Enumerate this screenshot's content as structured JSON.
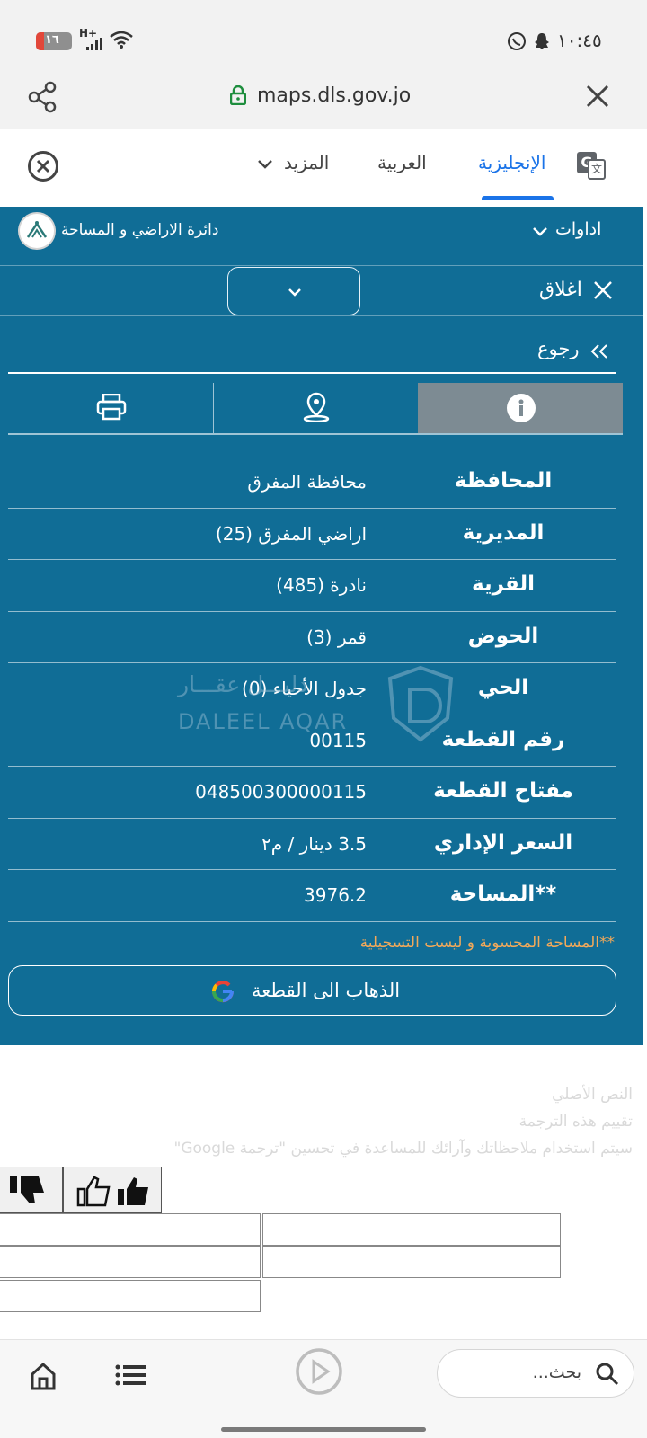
{
  "status_bar": {
    "time": "١٠:٤٥",
    "battery": "١٦",
    "network": "H+"
  },
  "browser": {
    "url": "maps.dls.gov.jo"
  },
  "translate_bar": {
    "tabs": [
      "الإنجليزية",
      "العربية",
      "المزيد"
    ]
  },
  "site_header": {
    "tools_label": "اداوات",
    "org_name": "دائرة الاراضي و المساحة"
  },
  "panel": {
    "close_label": "اغلاق",
    "back_label": "رجوع"
  },
  "info_rows": [
    {
      "label": "المحافظة",
      "value": "محافظة المفرق"
    },
    {
      "label": "المديرية",
      "value": "اراضي المفرق (25)"
    },
    {
      "label": "القرية",
      "value": "نادرة (485)"
    },
    {
      "label": "الحوض",
      "value": "قمر (3)"
    },
    {
      "label": "الحي",
      "value": "جدول الأحياء (0)"
    },
    {
      "label": "رقم القطعة",
      "value": "00115"
    },
    {
      "label": "مفتاح القطعة",
      "value": "048500300000115"
    },
    {
      "label": "السعر الإداري",
      "value": "3.5 دينار / م٢"
    },
    {
      "label": "**المساحة",
      "value": "3976.2"
    }
  ],
  "footnote": "**المساحة المحسوبة و ليست التسجيلية",
  "go_to_parcel_label": "الذهاب الى القطعة",
  "watermark": {
    "arabic": "دليـــل عقـــار",
    "latin": "DALEEL AQAR"
  },
  "translation_feedback": {
    "lines": [
      "النص الأصلي",
      "تقييم هذه الترجمة",
      "سيتم استخدام ملاحظاتك وآرائك للمساعدة في تحسين \"ترجمة Google\""
    ]
  },
  "bottom_nav": {
    "search_placeholder": "بحث..."
  },
  "colors": {
    "site_bg": "#106d96",
    "active_tab": "#1a73e8",
    "footnote": "#f2a95a",
    "info_tab_bg": "#7d8b93"
  }
}
